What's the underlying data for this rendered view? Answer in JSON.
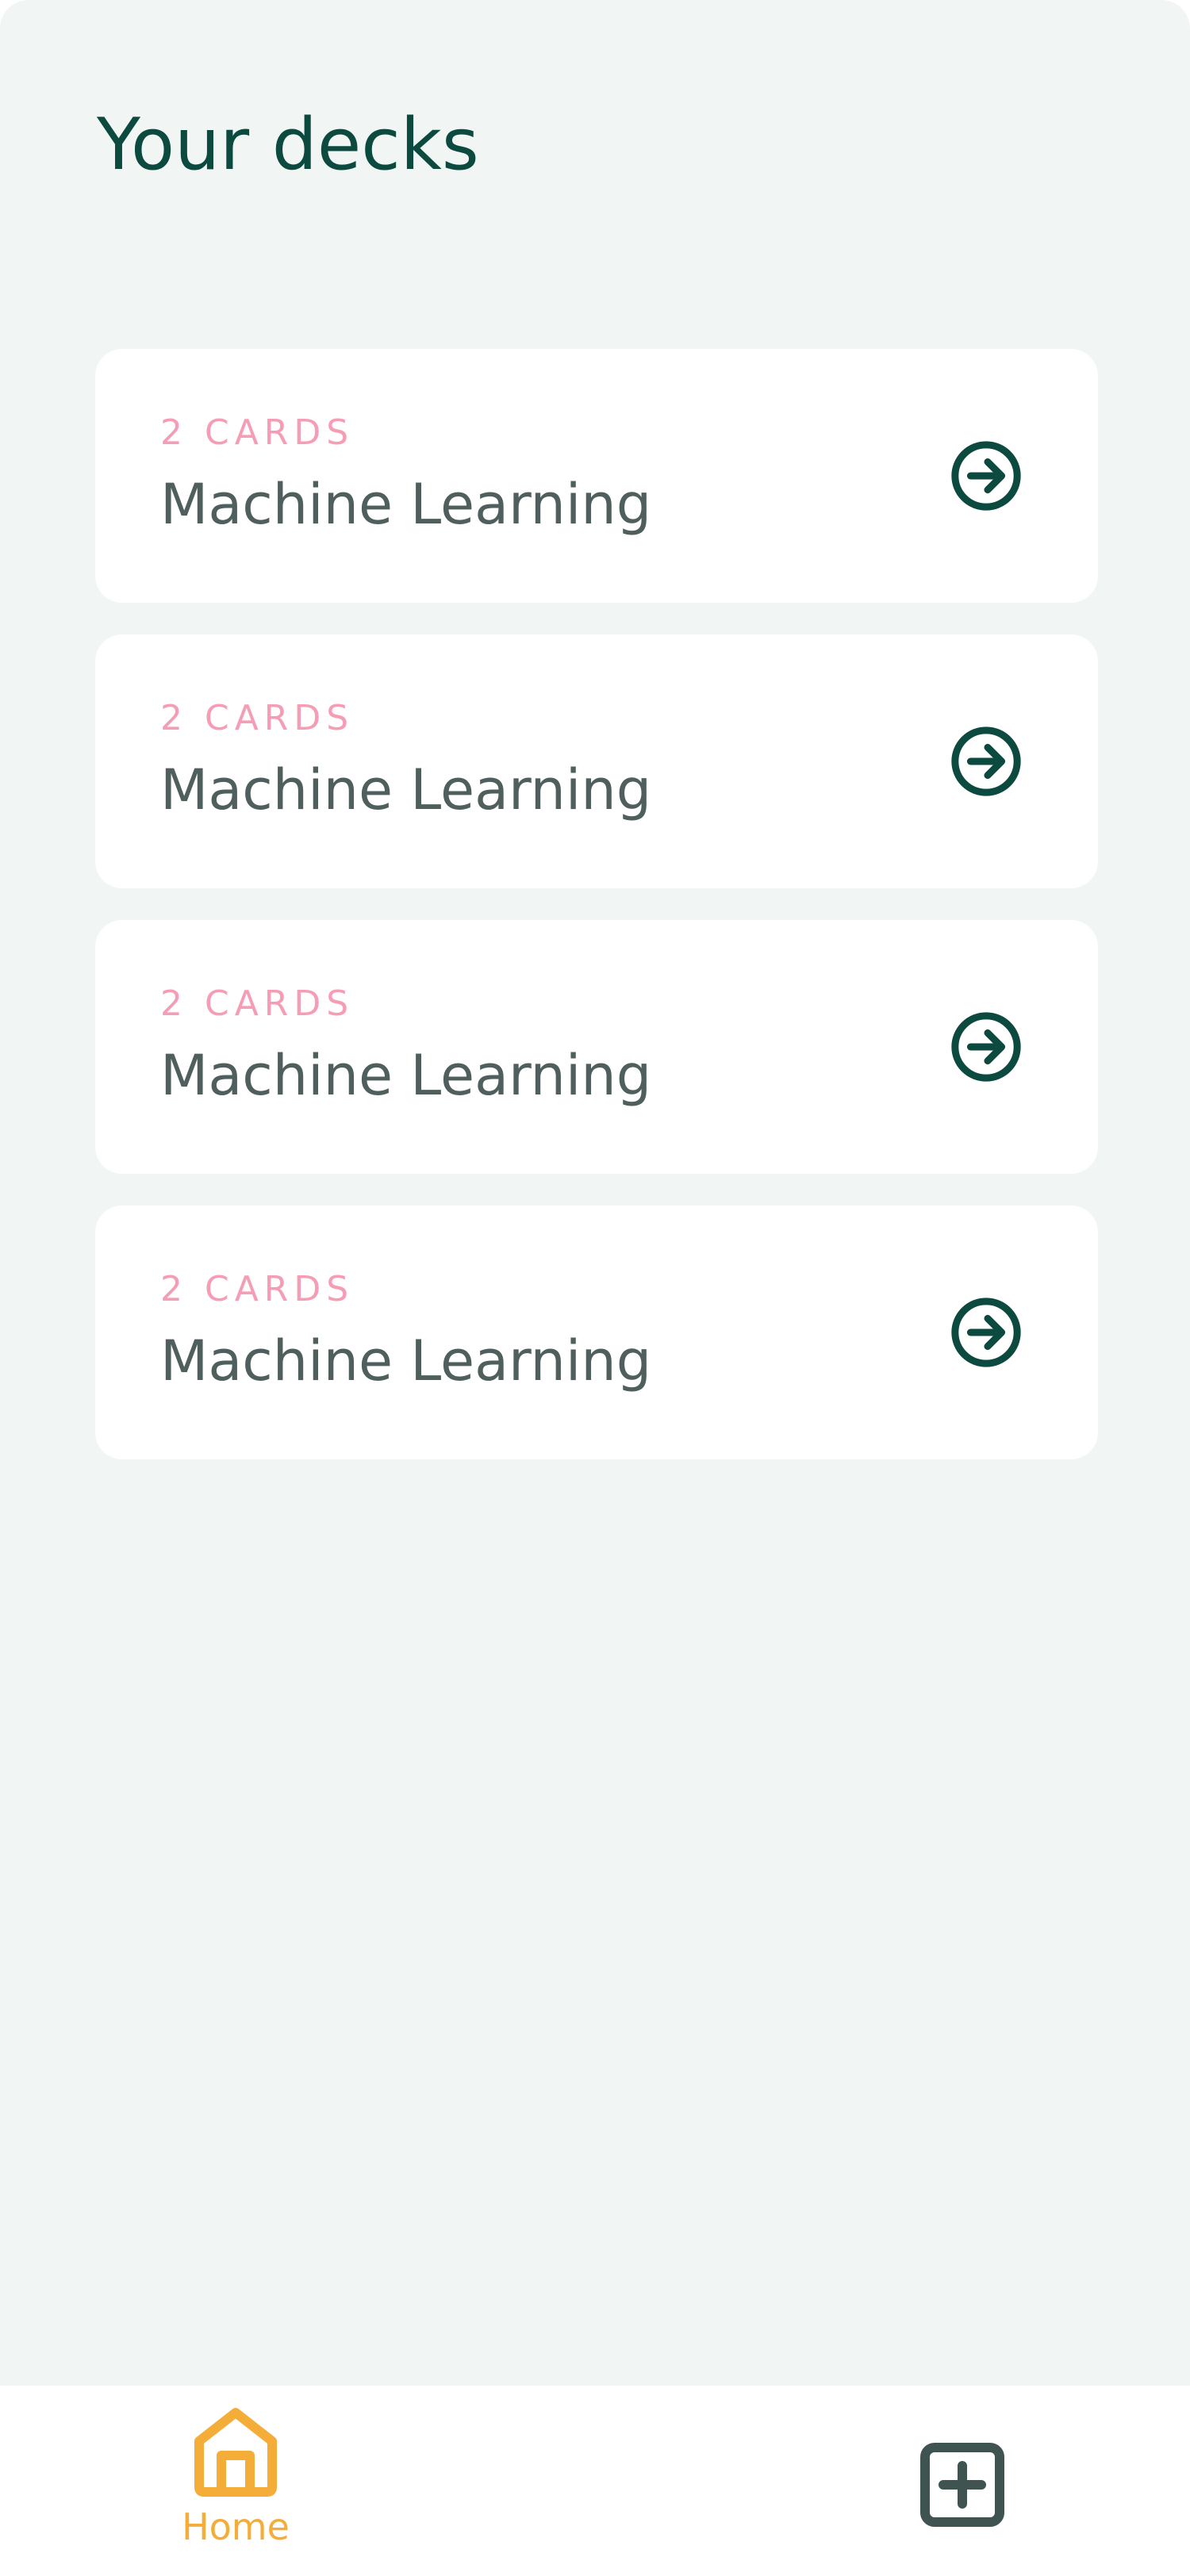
{
  "header": {
    "title": "Your decks"
  },
  "decks": [
    {
      "count": "2 CARDS",
      "name": "Machine Learning",
      "icon": "arrow-circle-right-icon"
    },
    {
      "count": "2 CARDS",
      "name": "Machine Learning",
      "icon": "arrow-circle-right-icon"
    },
    {
      "count": "2 CARDS",
      "name": "Machine Learning",
      "icon": "arrow-circle-right-icon"
    },
    {
      "count": "2 CARDS",
      "name": "Machine Learning",
      "icon": "arrow-circle-right-icon"
    }
  ],
  "tabbar": {
    "home": {
      "label": "Home",
      "icon": "home-icon",
      "active": true
    },
    "add": {
      "icon": "plus-square-icon"
    }
  },
  "colors": {
    "background": "#f1f5f4",
    "card": "#ffffff",
    "title": "#0c4a3f",
    "count": "#f59db5",
    "deck_name": "#4f5f5d",
    "icon": "#0c4a3f",
    "active_tab": "#f5ad3a",
    "inactive_tab": "#3f5350"
  }
}
